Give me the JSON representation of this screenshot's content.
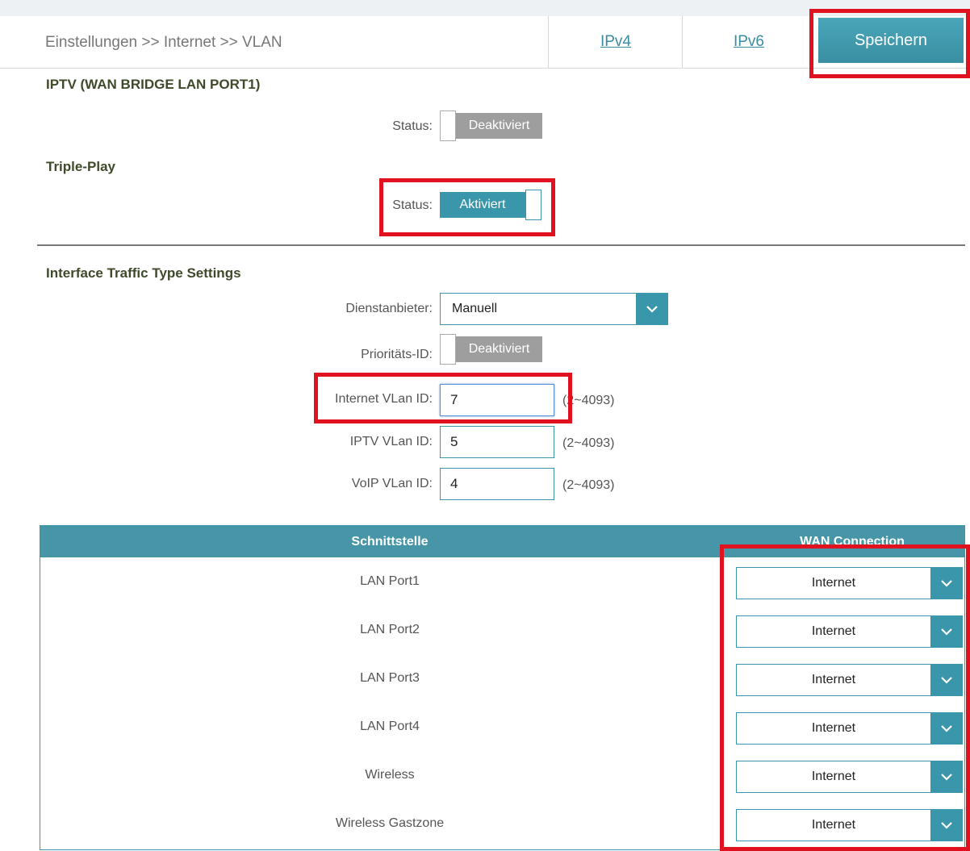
{
  "breadcrumb": "Einstellungen >> Internet >> VLAN",
  "tabs": {
    "ipv4": "IPv4",
    "ipv6": "IPv6"
  },
  "save_label": "Speichern",
  "iptv": {
    "title": "IPTV (WAN BRIDGE LAN PORT1)",
    "status_label": "Status:",
    "status_value": "Deaktiviert"
  },
  "triple_play": {
    "title": "Triple-Play",
    "status_label": "Status:",
    "status_value": "Aktiviert"
  },
  "traffic": {
    "title": "Interface Traffic Type Settings",
    "provider_label": "Dienstanbieter:",
    "provider_value": "Manuell",
    "priority_label": "Prioritäts-ID:",
    "priority_value": "Deaktiviert",
    "internet_vlan_label": "Internet VLan ID:",
    "internet_vlan_value": "7",
    "iptv_vlan_label": "IPTV VLan ID:",
    "iptv_vlan_value": "5",
    "voip_vlan_label": "VoIP VLan ID:",
    "voip_vlan_value": "4",
    "range_hint": "(2~4093)"
  },
  "table": {
    "col_interface": "Schnittstelle",
    "col_wan": "WAN Connection",
    "rows": [
      {
        "iface": "LAN Port1",
        "wan": "Internet"
      },
      {
        "iface": "LAN Port2",
        "wan": "Internet"
      },
      {
        "iface": "LAN Port3",
        "wan": "Internet"
      },
      {
        "iface": "LAN Port4",
        "wan": "Internet"
      },
      {
        "iface": "Wireless",
        "wan": "Internet"
      },
      {
        "iface": "Wireless Gastzone",
        "wan": "Internet"
      }
    ]
  },
  "colors": {
    "accent": "#3a96aa",
    "highlight": "#e1121f",
    "toggle_off": "#9e9e9e"
  }
}
